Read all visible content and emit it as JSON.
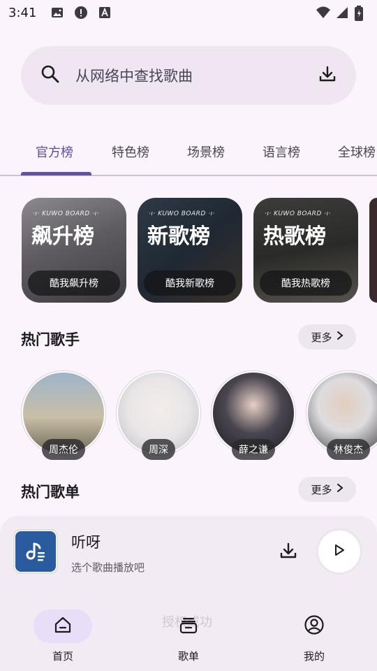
{
  "status_bar": {
    "time": "3:41",
    "icons": [
      "image-icon",
      "alert-icon",
      "a-font-icon"
    ],
    "right_icons": [
      "wifi-icon",
      "signal-icon",
      "battery-icon"
    ]
  },
  "search": {
    "placeholder": "从网络中查找歌曲",
    "icon": "search-icon",
    "download_icon": "download-icon"
  },
  "tabs": {
    "items": [
      "官方榜",
      "特色榜",
      "场景榜",
      "语言榜",
      "全球榜"
    ],
    "active_index": 0
  },
  "charts": [
    {
      "badge": "·ı· KUWO BOARD ·ı·",
      "title": "飙升榜",
      "button": "酷我飙升榜"
    },
    {
      "badge": "·ı· KUWO BOARD ·ı·",
      "title": "新歌榜",
      "button": "酷我新歌榜"
    },
    {
      "badge": "·ı· KUWO BOARD ·ı·",
      "title": "热歌榜",
      "button": "酷我热歌榜"
    }
  ],
  "artists_section": {
    "title": "热门歌手",
    "more": "更多",
    "items": [
      {
        "name": "周杰伦"
      },
      {
        "name": "周深"
      },
      {
        "name": "薛之谦"
      },
      {
        "name": "林俊杰"
      }
    ]
  },
  "playlists_section": {
    "title": "热门歌单",
    "more": "更多"
  },
  "player": {
    "title": "听呀",
    "subtitle": "选个歌曲播放吧",
    "download_icon": "download-icon",
    "play_icon": "play-icon"
  },
  "toast": "授权成功",
  "bottom_nav": {
    "items": [
      {
        "label": "首页",
        "icon": "home-icon"
      },
      {
        "label": "歌单",
        "icon": "playlist-icon"
      },
      {
        "label": "我的",
        "icon": "profile-icon"
      }
    ],
    "active_index": 0
  }
}
